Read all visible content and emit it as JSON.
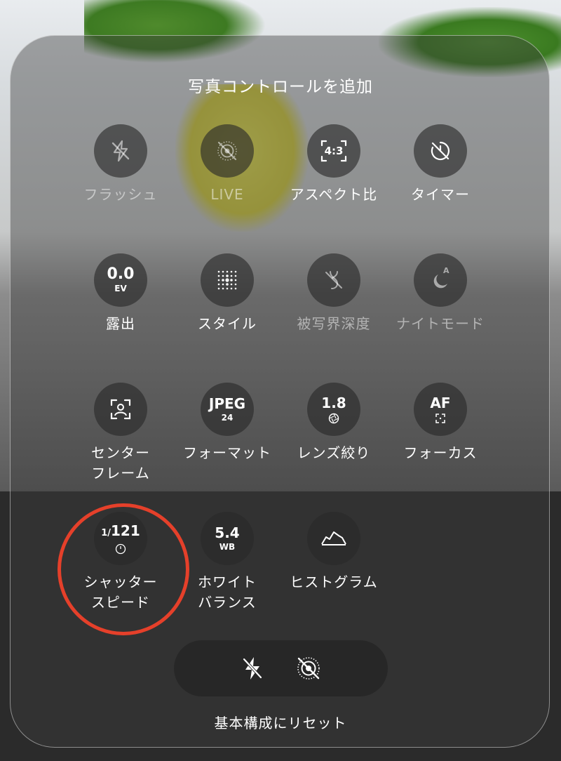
{
  "title": "写真コントロールを追加",
  "controls": {
    "flash": {
      "label": "フラッシュ",
      "icon": "flash-off-icon",
      "enabled": false
    },
    "live": {
      "label": "LIVE",
      "icon": "live-off-icon",
      "enabled": false
    },
    "aspect": {
      "label": "アスペクト比",
      "value": "4:3",
      "icon": "aspect-ratio-icon",
      "enabled": true
    },
    "timer": {
      "label": "タイマー",
      "icon": "timer-off-icon",
      "enabled": true
    },
    "exposure": {
      "label": "露出",
      "value": "0.0",
      "unit": "EV",
      "enabled": true
    },
    "style": {
      "label": "スタイル",
      "icon": "style-grid-icon",
      "enabled": true
    },
    "depth": {
      "label": "被写界深度",
      "icon": "depth-icon",
      "enabled": false
    },
    "night": {
      "label": "ナイトモード",
      "value": "A",
      "icon": "night-mode-icon",
      "enabled": false
    },
    "center_frame": {
      "label_line1": "センター",
      "label_line2": "フレーム",
      "icon": "center-frame-icon",
      "enabled": true
    },
    "format": {
      "label": "フォーマット",
      "value": "JPEG",
      "sub": "24",
      "enabled": true
    },
    "aperture": {
      "label": "レンズ絞り",
      "value": "1.8",
      "icon": "aperture-icon",
      "enabled": true
    },
    "focus": {
      "label": "フォーカス",
      "value": "AF",
      "icon": "focus-frame-icon",
      "enabled": true
    },
    "shutter": {
      "label_line1": "シャッター",
      "label_line2": "スピード",
      "value": "121",
      "prefix": "1/",
      "icon": "shutter-timer-icon",
      "enabled": true,
      "highlighted": true
    },
    "white_balance": {
      "label_line1": "ホワイト",
      "label_line2": "バランス",
      "value": "5.4",
      "sub": "WB",
      "enabled": true
    },
    "histogram": {
      "label": "ヒストグラム",
      "icon": "histogram-icon",
      "enabled": true
    }
  },
  "bottom_bar": {
    "icons": [
      "flash-off-icon",
      "live-off-icon"
    ]
  },
  "reset_label": "基本構成にリセット",
  "colors": {
    "highlight": "#e5402a",
    "panel": "#3c3c3c"
  }
}
